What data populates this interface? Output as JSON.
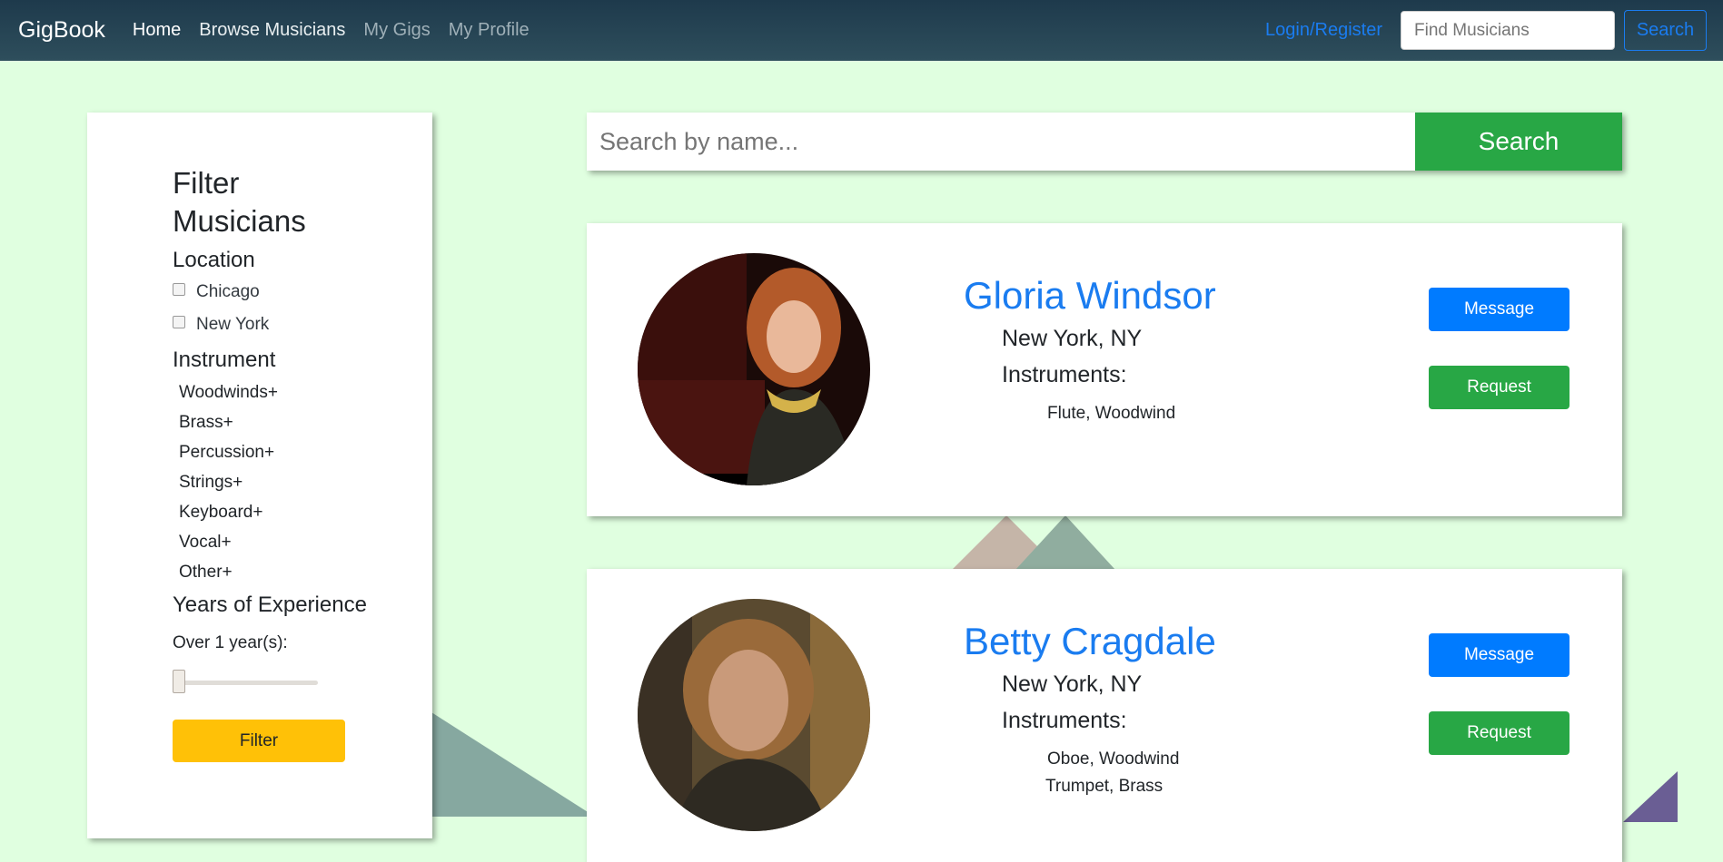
{
  "navbar": {
    "brand": "GigBook",
    "links": [
      "Home",
      "Browse Musicians",
      "My Gigs",
      "My Profile"
    ],
    "login": "Login/Register",
    "search_placeholder": "Find Musicians",
    "search_label": "Search"
  },
  "sidebar": {
    "title": "Filter Musicians",
    "location_heading": "Location",
    "locations": [
      "Chicago",
      "New York"
    ],
    "instrument_heading": "Instrument",
    "instruments": [
      "Woodwinds+",
      "Brass+",
      "Percussion+",
      "Strings+",
      "Keyboard+",
      "Vocal+",
      "Other+"
    ],
    "experience_heading": "Years of Experience",
    "experience_label": "Over 1 year(s):",
    "experience_value": 1,
    "filter_label": "Filter"
  },
  "main_search": {
    "placeholder": "Search by name...",
    "button": "Search"
  },
  "musicians": [
    {
      "name": "Gloria Windsor",
      "location": "New York, NY",
      "instruments_label": "Instruments:",
      "instruments": [
        "Flute, Woodwind"
      ],
      "message_label": "Message",
      "request_label": "Request"
    },
    {
      "name": "Betty Cragdale",
      "location": "New York, NY",
      "instruments_label": "Instruments:",
      "instruments": [
        "Oboe, Woodwind",
        "Trumpet, Brass"
      ],
      "message_label": "Message",
      "request_label": "Request"
    }
  ],
  "colors": {
    "background": "#e0ffe0",
    "link_blue": "#1a7cf0",
    "success_green": "#28a745",
    "primary_blue": "#007bff",
    "warning_yellow": "#ffc107"
  }
}
